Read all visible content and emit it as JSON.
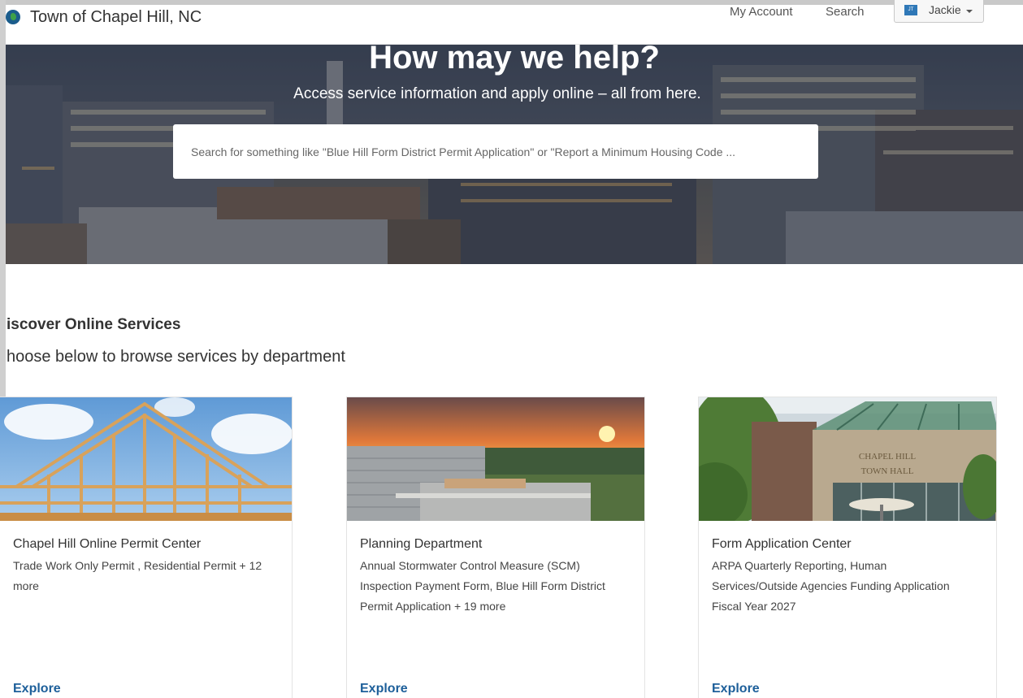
{
  "header": {
    "site_title": "Town of Chapel Hill, NC",
    "nav": {
      "my_account": "My Account",
      "search": "Search"
    },
    "user": {
      "initials": "JT",
      "name": "Jackie"
    }
  },
  "hero": {
    "title": "How may we help?",
    "subtitle": "Access service information and apply online – all from here.",
    "search_placeholder": "Search for something like \"Blue Hill Form District Permit Application\" or \"Report a Minimum Housing Code ..."
  },
  "section": {
    "title": "iscover Online Services",
    "subtitle": "hoose below to browse services by department"
  },
  "cards": [
    {
      "title": "Chapel Hill Online Permit Center",
      "desc_lines": [
        "Trade Work Only Permit , Residential Permit + 12",
        "more"
      ],
      "link": "Explore"
    },
    {
      "title": "Planning Department",
      "desc_lines": [
        "Annual Stormwater Control Measure (SCM)",
        "Inspection Payment Form, Blue Hill Form District",
        "Permit Application + 19 more"
      ],
      "link": "Explore"
    },
    {
      "title": "Form Application Center",
      "desc_lines": [
        "ARPA Quarterly Reporting, Human",
        "Services/Outside Agencies Funding Application",
        "Fiscal Year 2027"
      ],
      "link": "Explore"
    }
  ],
  "images": {
    "town_hall_sign": [
      "CHAPEL HILL",
      "TOWN HALL"
    ]
  },
  "colors": {
    "link_blue": "#1d5f9a",
    "avatar_blue": "#2f78b7",
    "hero_overlay": "#3c4658"
  }
}
